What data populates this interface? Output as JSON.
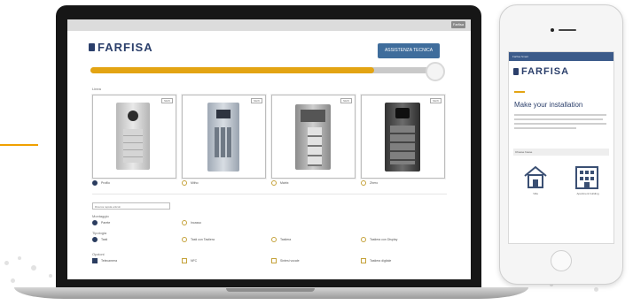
{
  "desktop": {
    "brand": "FARFISA",
    "top_button": "Farfisa",
    "assist_button": "ASSISTENZA TECNICA",
    "progress": 0.82,
    "section_line": "Linea",
    "products": [
      {
        "name": "Profilo",
        "tag": "NEW",
        "selected": true
      },
      {
        "name": "Mitho",
        "tag": "NEW",
        "selected": false
      },
      {
        "name": "Matrix",
        "tag": "NEW",
        "selected": false
      },
      {
        "name": "Zhero",
        "tag": "NEW",
        "selected": false
      }
    ],
    "search_placeholder": "Ricerca rapida articoli",
    "group1": {
      "title": "Montaggio",
      "options": [
        {
          "label": "Parete",
          "on": true
        },
        {
          "label": "Incasso",
          "on": false
        }
      ]
    },
    "group2": {
      "title": "Tipologia",
      "options": [
        {
          "label": "Tasti",
          "on": true
        },
        {
          "label": "Tasti con Tastiera",
          "on": false
        },
        {
          "label": "Tastiera",
          "on": false
        },
        {
          "label": "Tastiera con Display",
          "on": false
        }
      ]
    },
    "group3": {
      "title": "Opzioni",
      "options": [
        {
          "label": "Telecamera",
          "on": true
        },
        {
          "label": "NFC",
          "on": false
        },
        {
          "label": "Sintesi vocale",
          "on": false
        },
        {
          "label": "Tastiera digitale",
          "on": false
        }
      ]
    }
  },
  "mobile": {
    "topbar": "Farfisa Smart",
    "brand": "FARFISA",
    "heading": "Make your installation",
    "section": "Choose house",
    "icons": [
      {
        "label": "Villa",
        "icon": "house-icon"
      },
      {
        "label": "Apartment building",
        "icon": "building-icon"
      }
    ]
  },
  "colors": {
    "brand": "#2b3f6b",
    "accent": "#e3a413",
    "button": "#3f6d9c"
  }
}
